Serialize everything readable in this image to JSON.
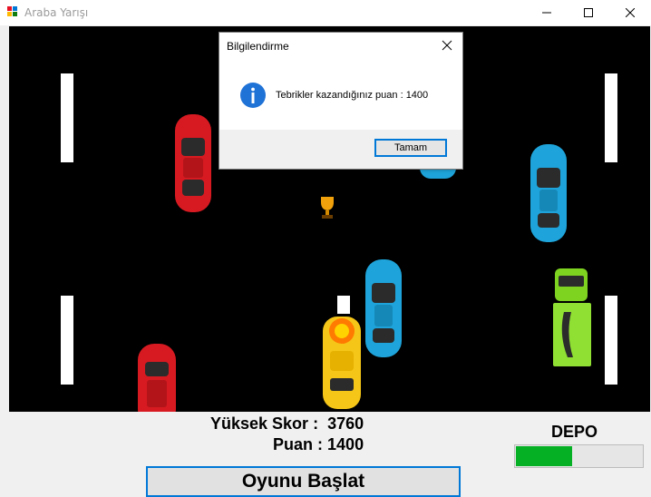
{
  "window": {
    "title": "Araba Yarışı",
    "controls": [
      "minimize-icon",
      "maximize-icon",
      "close-icon"
    ]
  },
  "game": {
    "background": "#000000",
    "cars": [
      {
        "name": "red-car-left",
        "color": "#d71a21"
      },
      {
        "name": "red-car-bottom",
        "color": "#d71a21"
      },
      {
        "name": "blue-car-right",
        "color": "#1ea4da"
      },
      {
        "name": "blue-car-top",
        "color": "#1ea4da"
      },
      {
        "name": "blue-car-center",
        "color": "#1ea4da"
      },
      {
        "name": "green-truck",
        "color": "#7ed321"
      },
      {
        "name": "yellow-player-car",
        "color": "#f5c518"
      }
    ],
    "icons": [
      "trophy-icon",
      "explosion-icon"
    ]
  },
  "dialog": {
    "title": "Bilgilendirme",
    "icon": "info-icon",
    "message": "Tebrikler kazandığınız puan : 1400",
    "ok_label": "Tamam"
  },
  "scoreboard": {
    "high_score_label": "Yüksek Skor :",
    "high_score_value": "3760",
    "points_label": "Puan  :",
    "points_value": "1400"
  },
  "fuel": {
    "label": "DEPO",
    "level": 0.44,
    "color": "#06b025"
  },
  "start_button": {
    "label": "Oyunu Başlat"
  }
}
